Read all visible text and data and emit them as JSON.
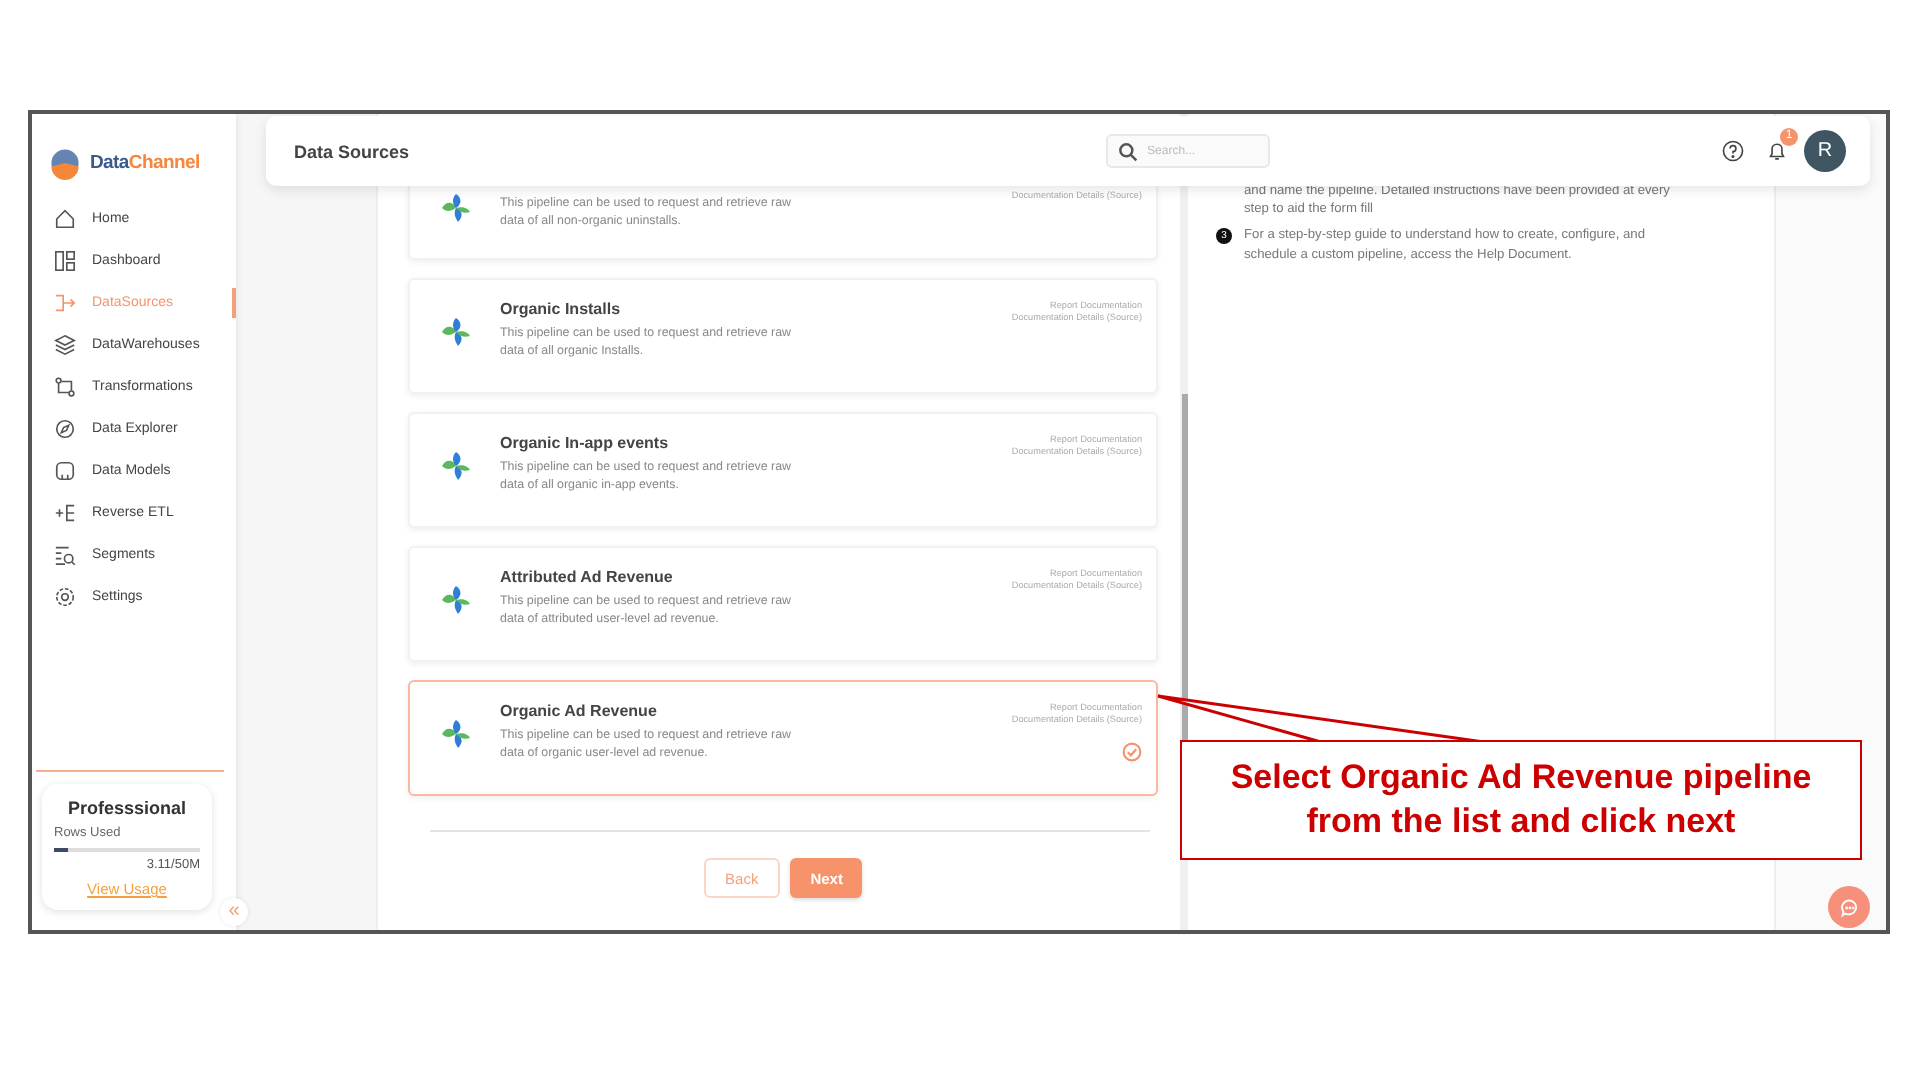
{
  "sidebar": {
    "logo": [
      "Data",
      "Channel"
    ],
    "nav": [
      {
        "label": "Home",
        "selected": false
      },
      {
        "label": "Dashboard",
        "selected": false
      },
      {
        "label": "DataSources",
        "selected": true
      },
      {
        "label": "DataWarehouses",
        "selected": false
      },
      {
        "label": "Transformations",
        "selected": false
      },
      {
        "label": "Data Explorer",
        "selected": false
      },
      {
        "label": "Data Models",
        "selected": false
      },
      {
        "label": "Reverse ETL",
        "selected": false
      },
      {
        "label": "Segments",
        "selected": false
      },
      {
        "label": "Settings",
        "selected": false
      }
    ],
    "plan": {
      "name": "Professsional",
      "rows_label": "Rows Used",
      "level": 0.09,
      "usage": "3.11/50M",
      "link": "View Usage"
    },
    "collapse": "«"
  },
  "header": {
    "title": "Data Sources",
    "search": {
      "placeholder": "Search..."
    },
    "notifications": "1",
    "avatar": "R"
  },
  "pipelines": [
    {
      "description": "This pipeline can be used to request and retrieve raw data of all non-organic uninstalls.",
      "links": [
        "Documentation Details (Source)"
      ],
      "selected": false
    },
    {
      "title": "Organic Installs",
      "description": "This pipeline can be used to request and retrieve raw data of all organic Installs.",
      "links": [
        "Report Documentation",
        "Documentation Details (Source)"
      ],
      "selected": false
    },
    {
      "title": "Organic In-app events",
      "description": "This pipeline can be used to request and retrieve raw data of all organic in-app events.",
      "links": [
        "Report Documentation",
        "Documentation Details (Source)"
      ],
      "selected": false
    },
    {
      "title": "Attributed Ad Revenue",
      "description": "This pipeline can be used to request and retrieve raw data of attributed user-level ad revenue.",
      "links": [
        "Report Documentation",
        "Documentation Details (Source)"
      ],
      "selected": false
    },
    {
      "title": "Organic Ad Revenue",
      "description": "This pipeline can be used to request and retrieve raw data of organic user-level ad revenue.",
      "links": [
        "Report Documentation",
        "Documentation Details (Source)"
      ],
      "selected": true
    }
  ],
  "buttons": {
    "back": "Back",
    "next": "Next"
  },
  "help": [
    {
      "text": "and name the pipeline. Detailed instructions have been provided at every step to aid the form fill"
    },
    {
      "marker": "3",
      "text": "For a step-by-step guide to understand how to create, configure, and schedule a custom pipeline, access the Help Document."
    }
  ],
  "callout": "Select Organic Ad Revenue pipeline from the list and click next"
}
